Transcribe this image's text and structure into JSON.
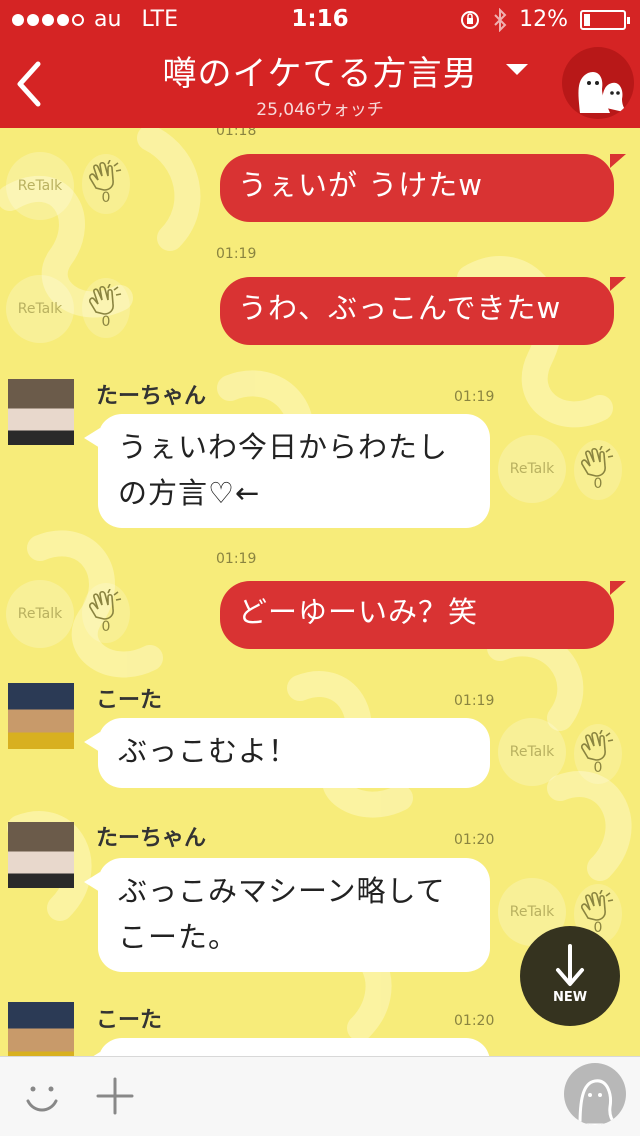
{
  "status_bar": {
    "carrier": "au",
    "network": "LTE",
    "time": "1:16",
    "battery": "12%",
    "signal_bars": 4
  },
  "header": {
    "title": "噂のイケてる方言男",
    "watch_count": "25,046ウォッチ",
    "back_icon": "chevron-left-icon",
    "dropdown_icon": "caret-down-icon",
    "mascot_icon": "ghost-mascot-icon"
  },
  "chat": {
    "retalk_label": "ReTalk",
    "messages": [
      {
        "side": "right",
        "time": "01:18",
        "text": "うぇいが うけたw",
        "claps": "0"
      },
      {
        "side": "right",
        "time": "01:19",
        "text": "うわ、ぶっこんできたw",
        "claps": "0"
      },
      {
        "side": "left",
        "sender": "たーちゃん",
        "time": "01:19",
        "line1": "うぇいわ今日からわたし",
        "line2": "の方言♡←",
        "claps": "0"
      },
      {
        "side": "right",
        "time": "01:19",
        "text": "どーゆーいみ？笑",
        "claps": "0"
      },
      {
        "side": "left",
        "sender": "こーた",
        "time": "01:19",
        "text": "ぶっこむよ！",
        "claps": "0"
      },
      {
        "side": "left",
        "sender": "たーちゃん",
        "time": "01:20",
        "line1": "ぶっこみマシーン略して",
        "line2": "こーた。",
        "claps": "0"
      },
      {
        "side": "left",
        "sender": "こーた",
        "time": "01:20",
        "text": "",
        "claps": ""
      }
    ]
  },
  "new_button": {
    "label": "NEW",
    "icon": "arrow-down-icon"
  },
  "bottom_bar": {
    "emoji_icon": "smiley-icon",
    "plus_icon": "plus-icon",
    "profile_icon": "ghost-profile-icon"
  },
  "colors": {
    "header_red": "#d52424",
    "bubble_red": "#d93333",
    "chat_bg": "#f7ec7a",
    "new_button_bg": "#35331f"
  }
}
